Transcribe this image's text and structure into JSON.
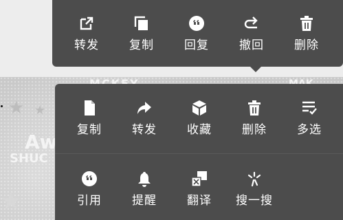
{
  "background": {
    "sticker_texts": [
      "MCKEY",
      "Aw",
      "SHUC",
      "MAK"
    ]
  },
  "top_menu": {
    "items": [
      {
        "label": "转发",
        "icon": "share-arrow-icon"
      },
      {
        "label": "复制",
        "icon": "copy-icon"
      },
      {
        "label": "回复",
        "icon": "quote-reply-icon"
      },
      {
        "label": "撤回",
        "icon": "undo-icon"
      },
      {
        "label": "删除",
        "icon": "trash-icon"
      }
    ]
  },
  "bottom_menu": {
    "row1": [
      {
        "label": "复制",
        "icon": "document-icon"
      },
      {
        "label": "转发",
        "icon": "forward-arrow-icon"
      },
      {
        "label": "收藏",
        "icon": "cube-icon"
      },
      {
        "label": "删除",
        "icon": "trash-icon"
      },
      {
        "label": "多选",
        "icon": "multi-select-icon"
      }
    ],
    "row2": [
      {
        "label": "引用",
        "icon": "quote-icon"
      },
      {
        "label": "提醒",
        "icon": "bell-icon"
      },
      {
        "label": "翻译",
        "icon": "translate-icon"
      },
      {
        "label": "搜一搜",
        "icon": "search-spark-icon"
      }
    ]
  },
  "colors": {
    "menu_bg": "#4c4c4c",
    "text": "#ffffff",
    "page_bg": "#ececec"
  }
}
